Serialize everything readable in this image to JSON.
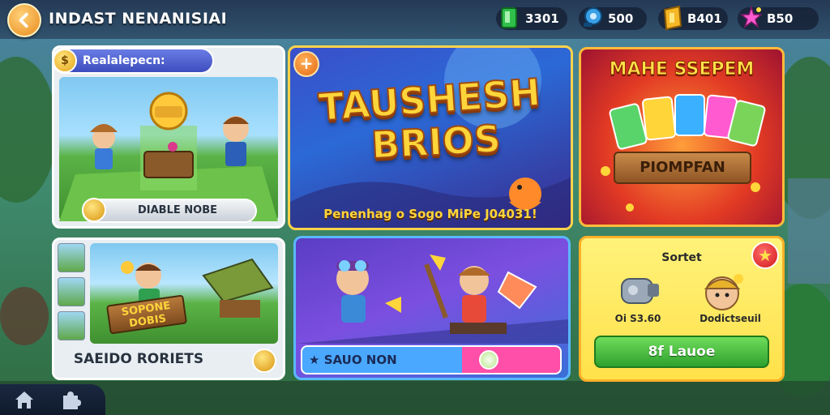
{
  "header": {
    "title": "INDAST NENANISIAI",
    "currencies": [
      {
        "icon": "green-gem-icon",
        "value": "3301"
      },
      {
        "icon": "blue-key-icon",
        "value": "500"
      },
      {
        "icon": "gold-ticket-icon",
        "value": "B401"
      },
      {
        "icon": "star-cluster-icon",
        "value": "B50"
      }
    ]
  },
  "cards": {
    "card_a": {
      "tag": "Realalepecn:",
      "button": "DIABLE NOBE"
    },
    "card_b": {
      "title_line1": "TAUSHESH",
      "title_line2": "BRIOS",
      "caption": "Penenhag o Sogo MiPe J04031!"
    },
    "card_c": {
      "title": "MAHE SSEPEM",
      "banner": "PIOMPFAN"
    },
    "card_d": {
      "label": "SAEIDO RORIETS",
      "sign": "SOPONE DOBIS"
    },
    "card_e": {
      "button": "SAUO NON"
    },
    "card_f": {
      "title": "Sortet",
      "item1_caption": "Oi S3.60",
      "item2_caption": "Dodictseuil",
      "button": "8f Lauoe"
    }
  },
  "colors": {
    "accent_orange": "#e88a1c",
    "gold": "#ffd53a",
    "green_button": "#2ea12e",
    "pink": "#ff4fa8",
    "blue": "#4aa8ff"
  }
}
